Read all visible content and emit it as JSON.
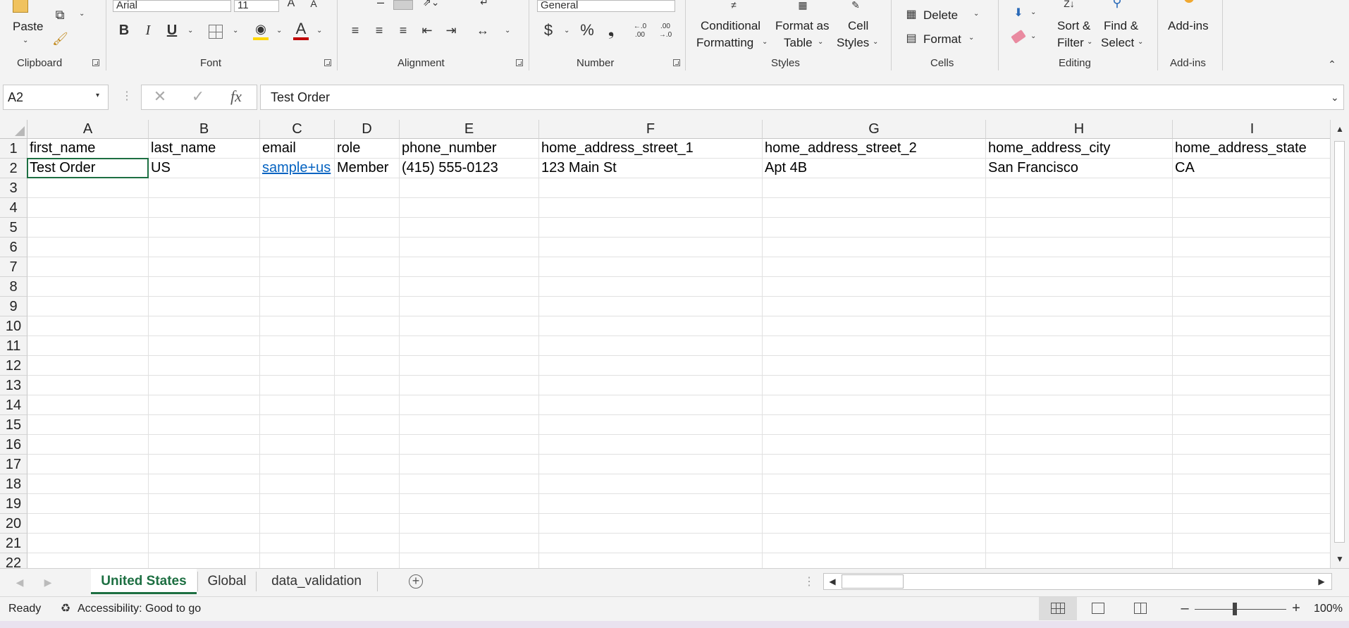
{
  "ribbon": {
    "clipboard": {
      "paste_label": "Paste",
      "group_label": "Clipboard"
    },
    "font": {
      "font_name": "Arial",
      "font_size": "11",
      "group_label": "Font",
      "bold": "B",
      "italic": "I",
      "underline": "U",
      "font_color_glyph": "A"
    },
    "alignment": {
      "group_label": "Alignment"
    },
    "number": {
      "format_value": "General",
      "group_label": "Number",
      "currency": "$",
      "percent": "%",
      "comma": "❟",
      "inc_decimal": "←.0 .00",
      "dec_decimal": ".00 →.0"
    },
    "styles": {
      "conditional_line1": "Conditional",
      "conditional_line2": "Formatting",
      "format_table_line1": "Format as",
      "format_table_line2": "Table",
      "cell_styles_line1": "Cell",
      "cell_styles_line2": "Styles",
      "group_label": "Styles"
    },
    "cells": {
      "delete_label": "Delete",
      "format_label": "Format",
      "group_label": "Cells"
    },
    "editing": {
      "sort_line1": "Sort &",
      "sort_line2": "Filter",
      "find_line1": "Find &",
      "find_line2": "Select",
      "group_label": "Editing"
    },
    "addins": {
      "label": "Add-ins",
      "group_label": "Add-ins"
    }
  },
  "formula_bar": {
    "name_box": "A2",
    "fx_label": "fx",
    "content": "Test Order"
  },
  "sheet": {
    "columns": [
      "A",
      "B",
      "C",
      "D",
      "E",
      "F",
      "G",
      "H",
      "I"
    ],
    "row_numbers": [
      "1",
      "2",
      "3",
      "4",
      "5",
      "6",
      "7",
      "8",
      "9",
      "10",
      "11",
      "12",
      "13",
      "14",
      "15",
      "16",
      "17",
      "18",
      "19",
      "20",
      "21",
      "22"
    ],
    "row1": [
      "first_name",
      "last_name",
      "email",
      "role",
      "phone_number",
      "home_address_street_1",
      "home_address_street_2",
      "home_address_city",
      "home_address_state"
    ],
    "row2": [
      "Test Order",
      "US",
      "sample+us",
      "Member",
      "(415) 555-0123",
      "123 Main St",
      "Apt 4B",
      "San Francisco",
      "CA"
    ]
  },
  "tabs": {
    "items": [
      "United States",
      "Global",
      "data_validation"
    ],
    "active": "United States"
  },
  "status": {
    "ready": "Ready",
    "accessibility": "Accessibility: Good to go",
    "zoom": "100%"
  },
  "colors": {
    "accent": "#1d6f42",
    "link": "#0563c1",
    "font_color_bar": "#c00000",
    "fill_color_bar": "#ffd700"
  }
}
